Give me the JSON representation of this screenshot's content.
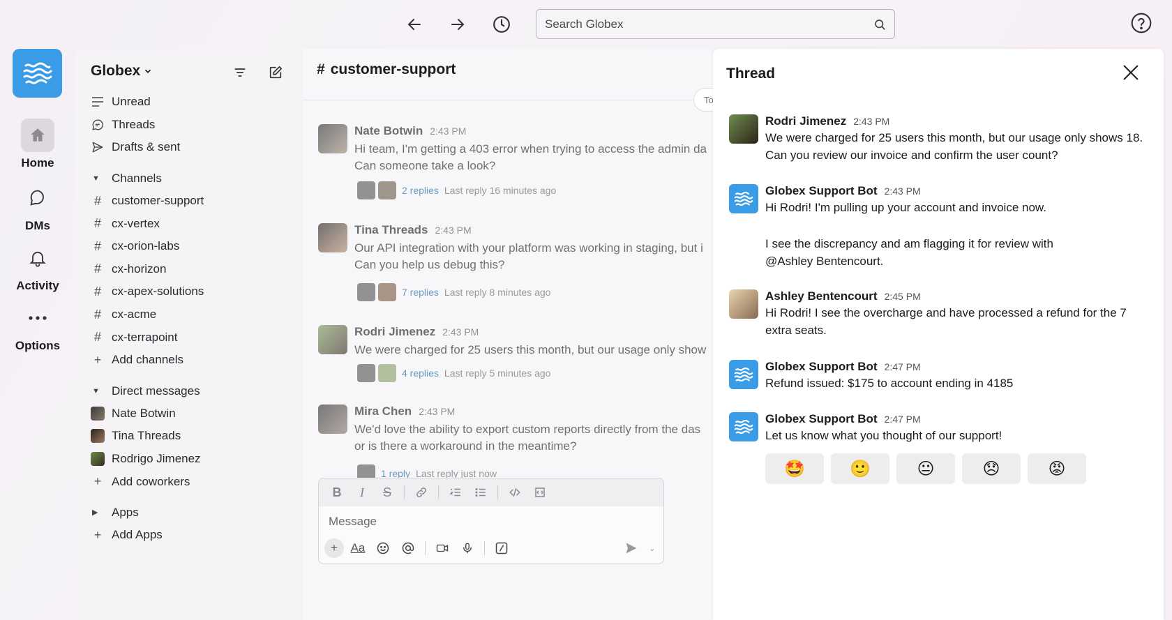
{
  "colors": {
    "accent": "#3a9be6",
    "link": "#1264a3"
  },
  "topbar": {
    "back_icon": "arrow-left-icon",
    "forward_icon": "arrow-right-icon",
    "history_icon": "clock-icon",
    "search_placeholder": "Search Globex",
    "help_icon": "question-circle-icon"
  },
  "rail": {
    "items": [
      {
        "label": "Home",
        "icon": "home-icon"
      },
      {
        "label": "DMs",
        "icon": "chat-bubble-icon"
      },
      {
        "label": "Activity",
        "icon": "bell-icon"
      },
      {
        "label": "Options",
        "icon": "ellipsis-icon"
      }
    ]
  },
  "sidebar": {
    "workspace_name": "Globex",
    "nav": [
      {
        "label": "Unread",
        "icon": "lines-icon"
      },
      {
        "label": "Threads",
        "icon": "thread-icon"
      },
      {
        "label": "Drafts & sent",
        "icon": "send-icon"
      }
    ],
    "channels_header": "Channels",
    "channels": [
      "customer-support",
      "cx-vertex",
      "cx-orion-labs",
      "cx-horizon",
      "cx-apex-solutions",
      "cx-acme",
      "cx-terrapoint"
    ],
    "add_channels": "Add channels",
    "dms_header": "Direct messages",
    "dms": [
      "Nate Botwin",
      "Tina Threads",
      "Rodrigo Jimenez"
    ],
    "add_coworkers": "Add coworkers",
    "apps_header": "Apps",
    "add_apps": "Add Apps"
  },
  "channel": {
    "name": "customer-support",
    "today_label": "To",
    "messages": [
      {
        "name": "Nate Botwin",
        "time": "2:43 PM",
        "lines": [
          "Hi team, I'm getting a 403 error when trying to access the admin da",
          "Can someone take a look?"
        ],
        "replies": "2 replies",
        "last_reply": "Last reply 16 minutes ago"
      },
      {
        "name": "Tina Threads",
        "time": "2:43 PM",
        "lines": [
          "Our API integration with your platform was working in staging, but i",
          "Can you help us debug this?"
        ],
        "replies": "7 replies",
        "last_reply": "Last reply 8 minutes ago"
      },
      {
        "name": "Rodri Jimenez",
        "time": "2:43 PM",
        "lines": [
          "We were charged for 25 users this month, but our usage only show"
        ],
        "replies": "4 replies",
        "last_reply": "Last reply 5 minutes ago"
      },
      {
        "name": "Mira Chen",
        "time": "2:43 PM",
        "lines": [
          "We'd love the ability to export custom reports directly from the das",
          "or is there a workaround in the meantime?"
        ],
        "replies": "1 reply",
        "last_reply": "Last reply just now"
      }
    ],
    "composer_placeholder": "Message"
  },
  "thread": {
    "title": "Thread",
    "messages": [
      {
        "name": "Rodri Jimenez",
        "time": "2:43 PM",
        "lines": [
          "We were charged for 25 users this month, but our usage only shows 18.",
          "Can you review our invoice and confirm the user count?"
        ]
      },
      {
        "name": "Globex Support Bot",
        "time": "2:43 PM",
        "lines": [
          "Hi Rodri! I'm pulling up your account and invoice now.",
          "I see the discrepancy and am flagging it for review with"
        ],
        "mention": "@Ashley Bentencourt."
      },
      {
        "name": "Ashley Bentencourt",
        "time": "2:45 PM",
        "lines": [
          "Hi Rodri! I see the overcharge and have processed a refund for the 7",
          "extra seats."
        ]
      },
      {
        "name": "Globex Support Bot",
        "time": "2:47 PM",
        "lines": [
          "Refund issued: $175 to account ending in 4185"
        ]
      },
      {
        "name": "Globex Support Bot",
        "time": "2:47 PM",
        "lines": [
          "Let us know what you thought of our support!"
        ]
      }
    ],
    "reactions": [
      "🤩",
      "🙂",
      "😐",
      "😞",
      "😡"
    ]
  }
}
